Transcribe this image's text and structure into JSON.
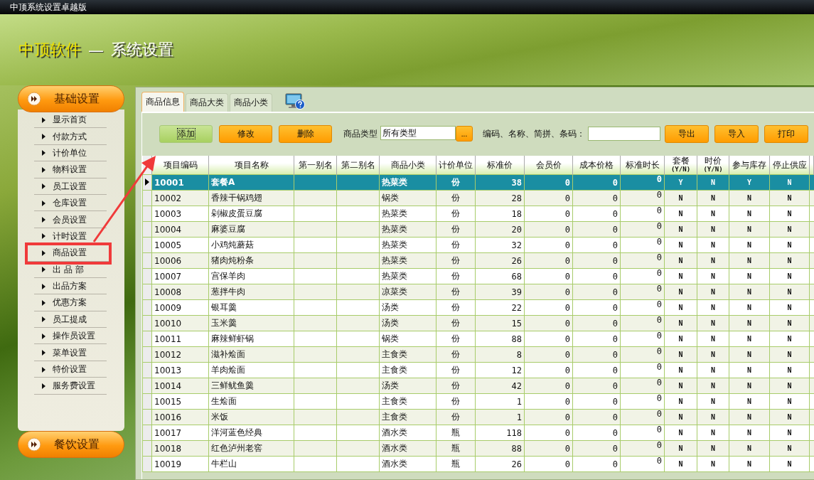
{
  "window": {
    "title": "中顶系统设置卓越版"
  },
  "header": {
    "brand": "中顶软件",
    "separator": "—",
    "title": "系统设置"
  },
  "sidebar": {
    "sections": [
      {
        "title": "基础设置",
        "expanded": true,
        "items": [
          {
            "label": "显示首页",
            "highlighted": false
          },
          {
            "label": "付款方式",
            "highlighted": false
          },
          {
            "label": "计价单位",
            "highlighted": false
          },
          {
            "label": "物料设置",
            "highlighted": false
          },
          {
            "label": "员工设置",
            "highlighted": false
          },
          {
            "label": "仓库设置",
            "highlighted": false
          },
          {
            "label": "会员设置",
            "highlighted": false
          },
          {
            "label": "计时设置",
            "highlighted": false
          },
          {
            "label": "商品设置",
            "highlighted": true
          },
          {
            "label": "出 品 部",
            "highlighted": false
          },
          {
            "label": "出品方案",
            "highlighted": false
          },
          {
            "label": "优惠方案",
            "highlighted": false
          },
          {
            "label": "员工提成",
            "highlighted": false
          },
          {
            "label": "操作员设置",
            "highlighted": false
          },
          {
            "label": "菜单设置",
            "highlighted": false
          },
          {
            "label": "特价设置",
            "highlighted": false
          },
          {
            "label": "服务费设置",
            "highlighted": false
          }
        ]
      },
      {
        "title": "餐饮设置",
        "expanded": false
      }
    ]
  },
  "tabs": [
    {
      "label": "商品信息",
      "selected": true
    },
    {
      "label": "商品大类",
      "selected": false
    },
    {
      "label": "商品小类",
      "selected": false
    }
  ],
  "toolbar": {
    "buttons": [
      {
        "label": "添加",
        "focused": true
      },
      {
        "label": "修改",
        "focused": false
      },
      {
        "label": "删除",
        "focused": false
      }
    ],
    "type_filter": {
      "label": "商品类型",
      "value": "所有类型",
      "browse": "..."
    },
    "search": {
      "label": "编码、名称、简拼、条码："
    },
    "actions": [
      "导出",
      "导入",
      "打印"
    ]
  },
  "table": {
    "columns": [
      {
        "label": "项目编码"
      },
      {
        "label": "项目名称"
      },
      {
        "label": "第一别名"
      },
      {
        "label": "第二别名"
      },
      {
        "label": "商品小类"
      },
      {
        "label": "计价单位"
      },
      {
        "label": "标准价"
      },
      {
        "label": "会员价"
      },
      {
        "label": "成本价格"
      },
      {
        "label": "标准时长"
      },
      {
        "label": "套餐",
        "sub": "(Y/N)"
      },
      {
        "label": "时价",
        "sub": "(Y/N)"
      },
      {
        "label": "参与库存"
      },
      {
        "label": "停止供应"
      }
    ],
    "rows": [
      {
        "selected": true,
        "code": "10001",
        "name": "套餐A",
        "sub_category": "热菜类",
        "unit": "份",
        "price": "38",
        "member_price": "0",
        "cost": "0",
        "duration": "0",
        "set_meal": "Y",
        "market_price": "N",
        "stock": "Y",
        "stopped": "N"
      },
      {
        "selected": false,
        "code": "10002",
        "name": "香辣干锅鸡翅",
        "sub_category": "锅类",
        "unit": "份",
        "price": "28",
        "member_price": "0",
        "cost": "0",
        "duration": "0",
        "set_meal": "N",
        "market_price": "N",
        "stock": "N",
        "stopped": "N"
      },
      {
        "selected": false,
        "code": "10003",
        "name": "剁椒皮蛋豆腐",
        "sub_category": "热菜类",
        "unit": "份",
        "price": "18",
        "member_price": "0",
        "cost": "0",
        "duration": "0",
        "set_meal": "N",
        "market_price": "N",
        "stock": "N",
        "stopped": "N"
      },
      {
        "selected": false,
        "code": "10004",
        "name": "麻婆豆腐",
        "sub_category": "热菜类",
        "unit": "份",
        "price": "20",
        "member_price": "0",
        "cost": "0",
        "duration": "0",
        "set_meal": "N",
        "market_price": "N",
        "stock": "N",
        "stopped": "N"
      },
      {
        "selected": false,
        "code": "10005",
        "name": "小鸡炖蘑菇",
        "sub_category": "热菜类",
        "unit": "份",
        "price": "32",
        "member_price": "0",
        "cost": "0",
        "duration": "0",
        "set_meal": "N",
        "market_price": "N",
        "stock": "N",
        "stopped": "N"
      },
      {
        "selected": false,
        "code": "10006",
        "name": "猪肉炖粉条",
        "sub_category": "热菜类",
        "unit": "份",
        "price": "26",
        "member_price": "0",
        "cost": "0",
        "duration": "0",
        "set_meal": "N",
        "market_price": "N",
        "stock": "N",
        "stopped": "N"
      },
      {
        "selected": false,
        "code": "10007",
        "name": "宫保羊肉",
        "sub_category": "热菜类",
        "unit": "份",
        "price": "68",
        "member_price": "0",
        "cost": "0",
        "duration": "0",
        "set_meal": "N",
        "market_price": "N",
        "stock": "N",
        "stopped": "N"
      },
      {
        "selected": false,
        "code": "10008",
        "name": "葱拌牛肉",
        "sub_category": "凉菜类",
        "unit": "份",
        "price": "39",
        "member_price": "0",
        "cost": "0",
        "duration": "0",
        "set_meal": "N",
        "market_price": "N",
        "stock": "N",
        "stopped": "N"
      },
      {
        "selected": false,
        "code": "10009",
        "name": "银耳羹",
        "sub_category": "汤类",
        "unit": "份",
        "price": "22",
        "member_price": "0",
        "cost": "0",
        "duration": "0",
        "set_meal": "N",
        "market_price": "N",
        "stock": "N",
        "stopped": "N"
      },
      {
        "selected": false,
        "code": "10010",
        "name": "玉米羹",
        "sub_category": "汤类",
        "unit": "份",
        "price": "15",
        "member_price": "0",
        "cost": "0",
        "duration": "0",
        "set_meal": "N",
        "market_price": "N",
        "stock": "N",
        "stopped": "N"
      },
      {
        "selected": false,
        "code": "10011",
        "name": "麻辣鲜虾锅",
        "sub_category": "锅类",
        "unit": "份",
        "price": "88",
        "member_price": "0",
        "cost": "0",
        "duration": "0",
        "set_meal": "N",
        "market_price": "N",
        "stock": "N",
        "stopped": "N"
      },
      {
        "selected": false,
        "code": "10012",
        "name": "滋补烩面",
        "sub_category": "主食类",
        "unit": "份",
        "price": "8",
        "member_price": "0",
        "cost": "0",
        "duration": "0",
        "set_meal": "N",
        "market_price": "N",
        "stock": "N",
        "stopped": "N"
      },
      {
        "selected": false,
        "code": "10013",
        "name": "羊肉烩面",
        "sub_category": "主食类",
        "unit": "份",
        "price": "12",
        "member_price": "0",
        "cost": "0",
        "duration": "0",
        "set_meal": "N",
        "market_price": "N",
        "stock": "N",
        "stopped": "N"
      },
      {
        "selected": false,
        "code": "10014",
        "name": "三鲜鱿鱼羹",
        "sub_category": "汤类",
        "unit": "份",
        "price": "42",
        "member_price": "0",
        "cost": "0",
        "duration": "0",
        "set_meal": "N",
        "market_price": "N",
        "stock": "N",
        "stopped": "N"
      },
      {
        "selected": false,
        "code": "10015",
        "name": "生烩面",
        "sub_category": "主食类",
        "unit": "份",
        "price": "1",
        "member_price": "0",
        "cost": "0",
        "duration": "0",
        "set_meal": "N",
        "market_price": "N",
        "stock": "N",
        "stopped": "N"
      },
      {
        "selected": false,
        "code": "10016",
        "name": "米饭",
        "sub_category": "主食类",
        "unit": "份",
        "price": "1",
        "member_price": "0",
        "cost": "0",
        "duration": "0",
        "set_meal": "N",
        "market_price": "N",
        "stock": "N",
        "stopped": "N"
      },
      {
        "selected": false,
        "code": "10017",
        "name": "洋河蓝色经典",
        "sub_category": "酒水类",
        "unit": "瓶",
        "price": "118",
        "member_price": "0",
        "cost": "0",
        "duration": "0",
        "set_meal": "N",
        "market_price": "N",
        "stock": "N",
        "stopped": "N"
      },
      {
        "selected": false,
        "code": "10018",
        "name": "红色泸州老窖",
        "sub_category": "酒水类",
        "unit": "瓶",
        "price": "88",
        "member_price": "0",
        "cost": "0",
        "duration": "0",
        "set_meal": "N",
        "market_price": "N",
        "stock": "N",
        "stopped": "N"
      },
      {
        "selected": false,
        "code": "10019",
        "name": "牛栏山",
        "sub_category": "酒水类",
        "unit": "瓶",
        "price": "26",
        "member_price": "0",
        "cost": "0",
        "duration": "0",
        "set_meal": "N",
        "market_price": "N",
        "stock": "N",
        "stopped": "N"
      }
    ]
  }
}
